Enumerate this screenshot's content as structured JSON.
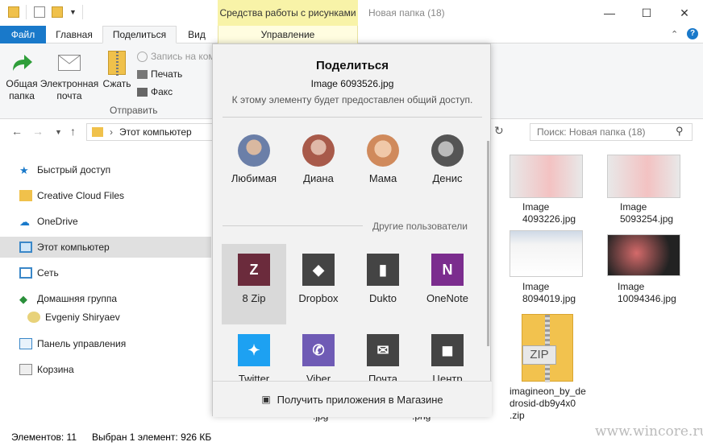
{
  "window": {
    "title": "Новая папка (18)",
    "context_tab": "Средства работы с рисунками",
    "controls": [
      "—",
      "☐",
      "✕"
    ]
  },
  "ribbon": {
    "tabs": {
      "file": "Файл",
      "home": "Главная",
      "share": "Поделиться",
      "view": "Вид",
      "manage": "Управление"
    },
    "send_group": {
      "shared_folder": "Общая\nпапка",
      "email": "Электронная\nпочта",
      "zip": "Сжать",
      "burn": "Запись на ком",
      "print": "Печать",
      "fax": "Факс",
      "group_label": "Отправить"
    }
  },
  "address": {
    "path": "Этот компьютер",
    "search_placeholder": "Поиск: Новая папка (18)"
  },
  "sidebar": {
    "items": [
      {
        "label": "Быстрый доступ",
        "icon": "star-icon"
      },
      {
        "label": "Creative Cloud Files",
        "icon": "creative-cloud-icon"
      },
      {
        "label": "OneDrive",
        "icon": "cloud-icon"
      },
      {
        "label": "Этот компьютер",
        "icon": "computer-icon",
        "active": true
      },
      {
        "label": "Сеть",
        "icon": "network-icon"
      },
      {
        "label": "Домашняя группа",
        "icon": "homegroup-icon"
      },
      {
        "label": "Evgeniy Shiryaev",
        "icon": "user-icon"
      },
      {
        "label": "Панель управления",
        "icon": "control-panel-icon"
      },
      {
        "label": "Корзина",
        "icon": "recycle-bin-icon"
      }
    ]
  },
  "files": [
    {
      "name": "Image\n4093226.jpg"
    },
    {
      "name": "Image\n5093254.jpg"
    },
    {
      "name": "Image\n8094019.jpg"
    },
    {
      "name": "Image\n10094346.jpg"
    },
    {
      "name": "imagineon_by_de\ndrosid-db9y4x0\n.zip"
    },
    {
      "name": ".jpg"
    },
    {
      "name": ".png"
    }
  ],
  "zip_badge": "ZIP",
  "status": {
    "count": "Элементов: 11",
    "selected": "Выбран 1 элемент: 926 КБ"
  },
  "share": {
    "title": "Поделиться",
    "file": "Image 6093526.jpg",
    "note": "К этому элементу будет предоставлен общий доступ.",
    "contacts": [
      {
        "name": "Любимая",
        "color": "#6b7fa8"
      },
      {
        "name": "Диана",
        "color": "#a85a4a"
      },
      {
        "name": "Мама",
        "color": "#d08a5c"
      },
      {
        "name": "Денис",
        "color": "#777777"
      }
    ],
    "other_users": "Другие пользователи",
    "apps": [
      {
        "name": "8 Zip",
        "color": "#6b2b3c",
        "glyph": "Z",
        "selected": true
      },
      {
        "name": "Dropbox",
        "color": "#444444",
        "glyph": "◆"
      },
      {
        "name": "Dukto",
        "color": "#444444",
        "glyph": "▮"
      },
      {
        "name": "OneNote",
        "color": "#7b2d8e",
        "glyph": "N"
      },
      {
        "name": "Twitter",
        "color": "#1da1f2",
        "glyph": "✦"
      },
      {
        "name": "Viber",
        "color": "#6f5bb5",
        "glyph": "✆"
      },
      {
        "name": "Почта",
        "color": "#444444",
        "glyph": "✉"
      },
      {
        "name": "Центр",
        "color": "#444444",
        "glyph": "◼"
      }
    ],
    "footer": "Получить приложения в Магазине"
  },
  "watermark": "www.wincore.ru"
}
